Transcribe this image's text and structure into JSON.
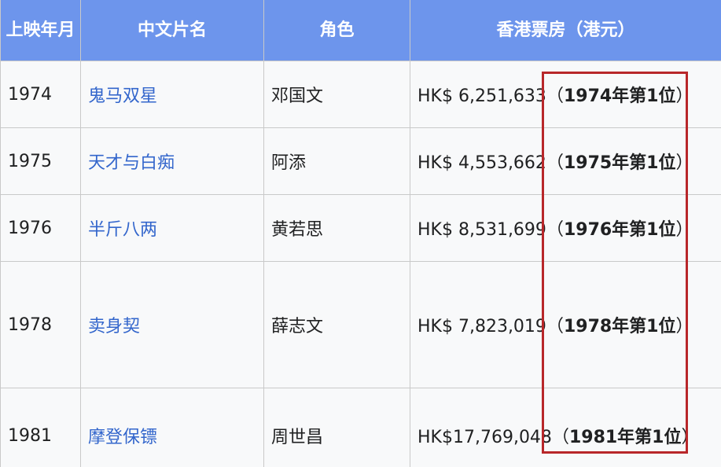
{
  "headers": {
    "year": "上映年月",
    "title": "中文片名",
    "role": "角色",
    "box_office": "香港票房（港元）"
  },
  "rows": [
    {
      "year": "1974",
      "title": "鬼马双星",
      "role": "邓国文",
      "box_office": "HK$ 6,251,633",
      "rank_open": "（",
      "rank": "1974年第1位",
      "rank_close": "）"
    },
    {
      "year": "1975",
      "title": "天才与白痴",
      "role": "阿添",
      "box_office": "HK$ 4,553,662",
      "rank_open": "（",
      "rank": "1975年第1位",
      "rank_close": "）"
    },
    {
      "year": "1976",
      "title": "半斤八两",
      "role": "黄若思",
      "box_office": "HK$ 8,531,699",
      "rank_open": "（",
      "rank": "1976年第1位",
      "rank_close": "）"
    },
    {
      "year": "1978",
      "title": "卖身契",
      "role": "薛志文",
      "box_office": "HK$ 7,823,019",
      "rank_open": "（",
      "rank": "1978年第1位",
      "rank_close": "）"
    },
    {
      "year": "1981",
      "title": "摩登保镖",
      "role": "周世昌",
      "box_office": "HK$17,769,048",
      "rank_open": "（",
      "rank": "1981年第1位",
      "rank_close": "）"
    }
  ],
  "colors": {
    "header_bg": "#6d95ec",
    "link": "#3366cc",
    "highlight_border": "#b8272a"
  }
}
